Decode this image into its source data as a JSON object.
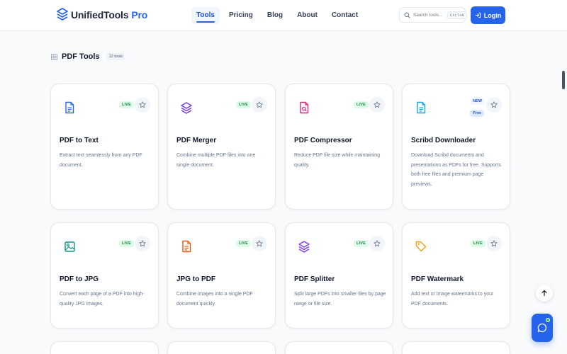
{
  "brand": {
    "name": "UnifiedTools",
    "suffix": "Pro",
    "accent": "#2563eb"
  },
  "nav": [
    {
      "label": "Tools",
      "active": true
    },
    {
      "label": "Pricing"
    },
    {
      "label": "Blog"
    },
    {
      "label": "About"
    },
    {
      "label": "Contact"
    }
  ],
  "search": {
    "placeholder": "Search tools...",
    "shortcut": "Ctrl+K"
  },
  "login_label": "Login",
  "section": {
    "title": "PDF Tools",
    "count": "12 tools"
  },
  "tools": [
    {
      "title": "PDF to Text",
      "desc": "Extract text seamlessly from any PDF document.",
      "badge": "LIVE",
      "icon": "file-text-icon",
      "color": "#2563eb"
    },
    {
      "title": "PDF Merger",
      "desc": "Combine multiple PDF files into one single document.",
      "badge": "LIVE",
      "icon": "layers-icon",
      "color": "#7c3aed"
    },
    {
      "title": "PDF Compressor",
      "desc": "Reduce PDF file size while maintaining quality.",
      "badge": "LIVE",
      "icon": "file-search-icon",
      "color": "#db2777"
    },
    {
      "title": "Scribd Downloader",
      "desc": "Download Scribd documents and presentations as PDFs for free. Supports both free files and premium page previews.",
      "badge_new": "NEW",
      "badge_free": "Free",
      "icon": "file-text-icon",
      "color": "#0ea5e9"
    },
    {
      "title": "PDF to JPG",
      "desc": "Convert each page of a PDF into high-quality JPG images.",
      "badge": "LIVE",
      "icon": "image-icon",
      "color": "#0d9488"
    },
    {
      "title": "JPG to PDF",
      "desc": "Combine images into a single PDF document quickly.",
      "badge": "LIVE",
      "icon": "file-text-icon",
      "color": "#ea580c"
    },
    {
      "title": "PDF Splitter",
      "desc": "Split large PDFs into smaller files by page range or file size.",
      "badge": "LIVE",
      "icon": "layers-icon",
      "color": "#7c3aed"
    },
    {
      "title": "PDF Watermark",
      "desc": "Add text or image watermarks to your PDF documents.",
      "badge": "LIVE",
      "icon": "tag-icon",
      "color": "#f59e0b"
    }
  ]
}
